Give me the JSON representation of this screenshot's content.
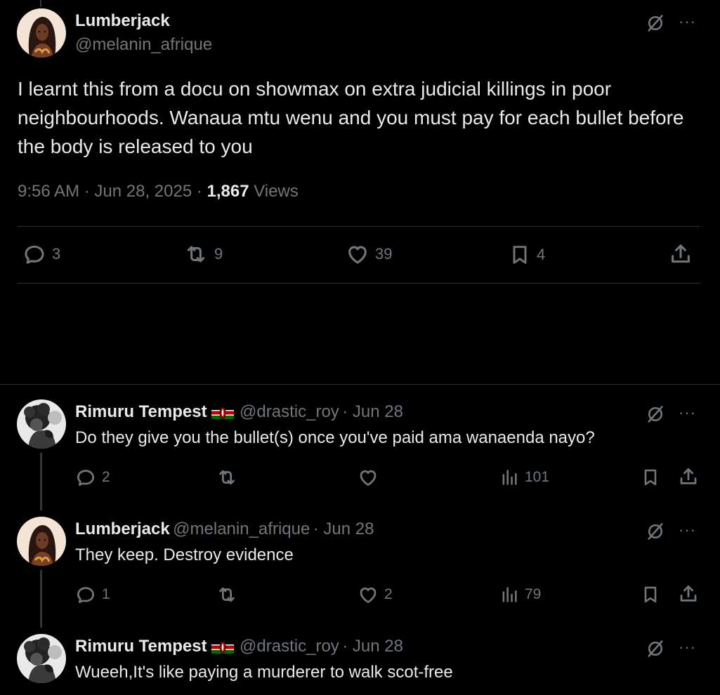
{
  "main_tweet": {
    "name": "Lumberjack",
    "handle": "@melanin_afrique",
    "text": "I learnt this from a docu on showmax on extra judicial killings in poor neighbourhoods. Wanaua mtu wenu and you must pay for each bullet before the body is released to you",
    "time": "9:56 AM · Jun 28, 2025 · ",
    "views_count": "1,867",
    "views_label": " Views",
    "replies": "3",
    "reposts": "9",
    "likes": "39",
    "bookmarks": "4"
  },
  "replies": [
    {
      "name": "Rimuru Tempest",
      "handle": "@drastic_roy",
      "date": "· Jun 28",
      "text": "Do they give you the bullet(s) once you've paid ama wanaenda nayo?",
      "replies": "2",
      "reposts": "",
      "likes": "",
      "views": "101"
    },
    {
      "name": "Lumberjack",
      "handle": "@melanin_afrique",
      "date": "· Jun 28",
      "text": "They keep. Destroy evidence",
      "replies": "1",
      "reposts": "",
      "likes": "2",
      "views": "79"
    },
    {
      "name": "Rimuru Tempest",
      "handle": "@drastic_roy",
      "date": "· Jun 28",
      "text": "Wueeh,It's like paying a murderer to walk scot-free"
    }
  ],
  "colors": {
    "background": "#000000",
    "text": "#e7e9ea",
    "muted": "#71767b",
    "divider": "#2f3336"
  },
  "icons": {
    "grok": "grok-slash-circle-icon",
    "more": "more-dots-icon",
    "reply": "speech-bubble-icon",
    "repost": "repost-arrows-icon",
    "like": "heart-icon",
    "bookmark": "bookmark-icon",
    "share": "share-upload-icon",
    "views": "bar-chart-icon"
  },
  "more_glyph": "···"
}
